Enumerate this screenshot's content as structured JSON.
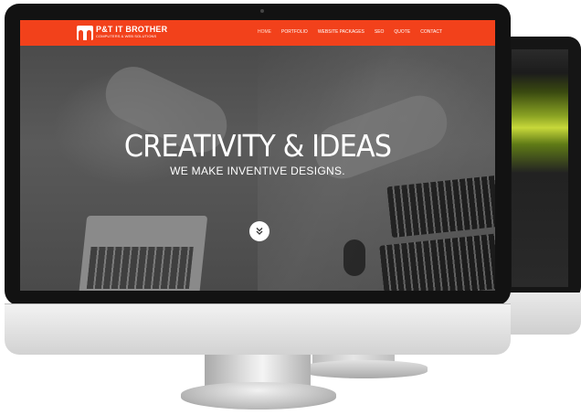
{
  "brand": {
    "name": "P&T IT BROTHER",
    "tagline": "COMPUTERS & WEB SOLUTIONS",
    "accent_color": "#f2411b"
  },
  "nav": {
    "items": [
      {
        "label": "HOME",
        "active": true
      },
      {
        "label": "PORTFOLIO",
        "active": false
      },
      {
        "label": "WEBSITE PACKAGES",
        "active": false
      },
      {
        "label": "SEO",
        "active": false
      },
      {
        "label": "QUOTE",
        "active": false
      },
      {
        "label": "CONTACT",
        "active": false
      }
    ]
  },
  "hero": {
    "title": "CREATIVITY & IDEAS",
    "subtitle": "WE MAKE INVENTIVE DESIGNS.",
    "scroll_icon": "double-chevron-down-icon"
  }
}
